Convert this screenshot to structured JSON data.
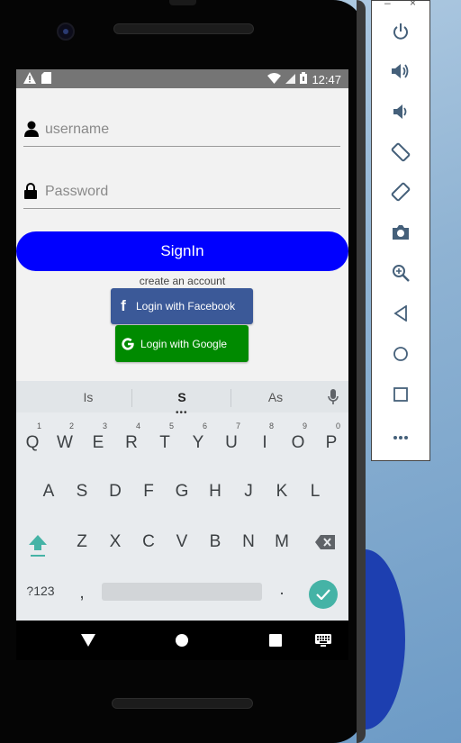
{
  "status_bar": {
    "time": "12:47"
  },
  "form": {
    "username_placeholder": "username",
    "password_placeholder": "Password",
    "signin_label": "SignIn",
    "create_account": "create an account",
    "facebook_label": "Login with Facebook",
    "google_label": "Login with Google"
  },
  "keyboard": {
    "suggestions": [
      "Is",
      "S",
      "As"
    ],
    "row1": [
      {
        "key": "Q",
        "num": "1"
      },
      {
        "key": "W",
        "num": "2"
      },
      {
        "key": "E",
        "num": "3"
      },
      {
        "key": "R",
        "num": "4"
      },
      {
        "key": "T",
        "num": "5"
      },
      {
        "key": "Y",
        "num": "6"
      },
      {
        "key": "U",
        "num": "7"
      },
      {
        "key": "I",
        "num": "8"
      },
      {
        "key": "O",
        "num": "9"
      },
      {
        "key": "P",
        "num": "0"
      }
    ],
    "row2": [
      "A",
      "S",
      "D",
      "F",
      "G",
      "H",
      "J",
      "K",
      "L"
    ],
    "row3": [
      "Z",
      "X",
      "C",
      "V",
      "B",
      "N",
      "M"
    ],
    "symbols_label": "?123",
    "comma": ",",
    "period": "."
  },
  "colors": {
    "signin": "#0000ff",
    "facebook": "#3b5998",
    "google": "#008a00",
    "enter": "#45b3a6",
    "shift": "#45b3a6"
  }
}
